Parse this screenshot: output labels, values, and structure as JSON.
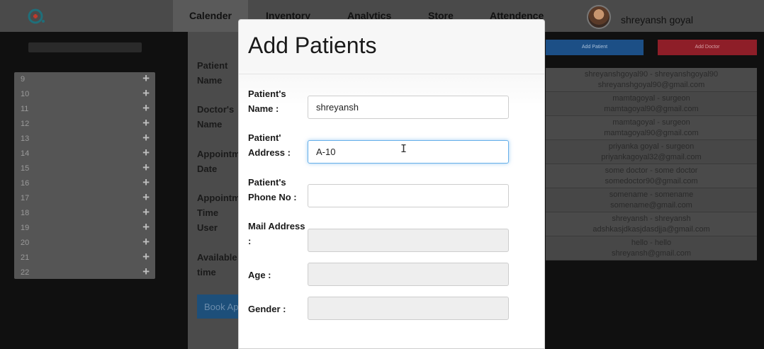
{
  "nav": {
    "items": [
      "Calender",
      "Inventory",
      "Analytics",
      "Store",
      "Attendence"
    ],
    "active": "Calender",
    "user_name": "shreyansh goyal"
  },
  "sidebar": {
    "hours": [
      "9",
      "10",
      "11",
      "12",
      "13",
      "14",
      "15",
      "16",
      "17",
      "18",
      "19",
      "20",
      "21",
      "22"
    ],
    "add_symbol": "+"
  },
  "booking_form": {
    "labels": [
      "Patient Name",
      "Doctor's Name",
      "Appointment Date",
      "Appointment Time User Wants",
      "Available time"
    ],
    "book_button": "Book Appointment"
  },
  "doctor_panel": {
    "add_patient_button": "Add Patient",
    "add_doctor_button": "Add Doctor",
    "doctors": [
      {
        "line1": "shreyanshgoyal90  -  shreyanshgoyal90",
        "line2": "shreyanshgoyal90@gmail.com"
      },
      {
        "line1": "mamtagoyal  -  surgeon",
        "line2": "mamtagoyal90@gmail.com"
      },
      {
        "line1": "mamtagoyal  -  surgeon",
        "line2": "mamtagoyal90@gmail.com"
      },
      {
        "line1": "priyanka goyal  -  surgeon",
        "line2": "priyankagoyal32@gmail.com"
      },
      {
        "line1": "some doctor  -  some doctor",
        "line2": "somedoctor90@gmail.com"
      },
      {
        "line1": "somename  -  somename",
        "line2": "somename@gmail.com"
      },
      {
        "line1": "shreyansh  -  shreyansh",
        "line2": "adshkasjdkasjdasdjja@gmail.com"
      },
      {
        "line1": "hello  -  hello",
        "line2": "shreyansh@gmail.com"
      }
    ]
  },
  "modal": {
    "title": "Add Patients",
    "fields": {
      "name": {
        "label": "Patient's Name :",
        "value": "shreyansh"
      },
      "address": {
        "label": "Patient' Address :",
        "value": "A-10"
      },
      "phone": {
        "label": "Patient's Phone No :",
        "value": ""
      },
      "mail": {
        "label": "Mail Address :",
        "value": ""
      },
      "age": {
        "label": "Age :",
        "value": ""
      },
      "gender": {
        "label": "Gender :",
        "value": ""
      }
    }
  },
  "colors": {
    "focus_border": "#66afe9",
    "add_patient_bg": "#1c4f86",
    "add_doctor_bg": "#8e1e28",
    "nav_bg": "#4a4a4a"
  }
}
